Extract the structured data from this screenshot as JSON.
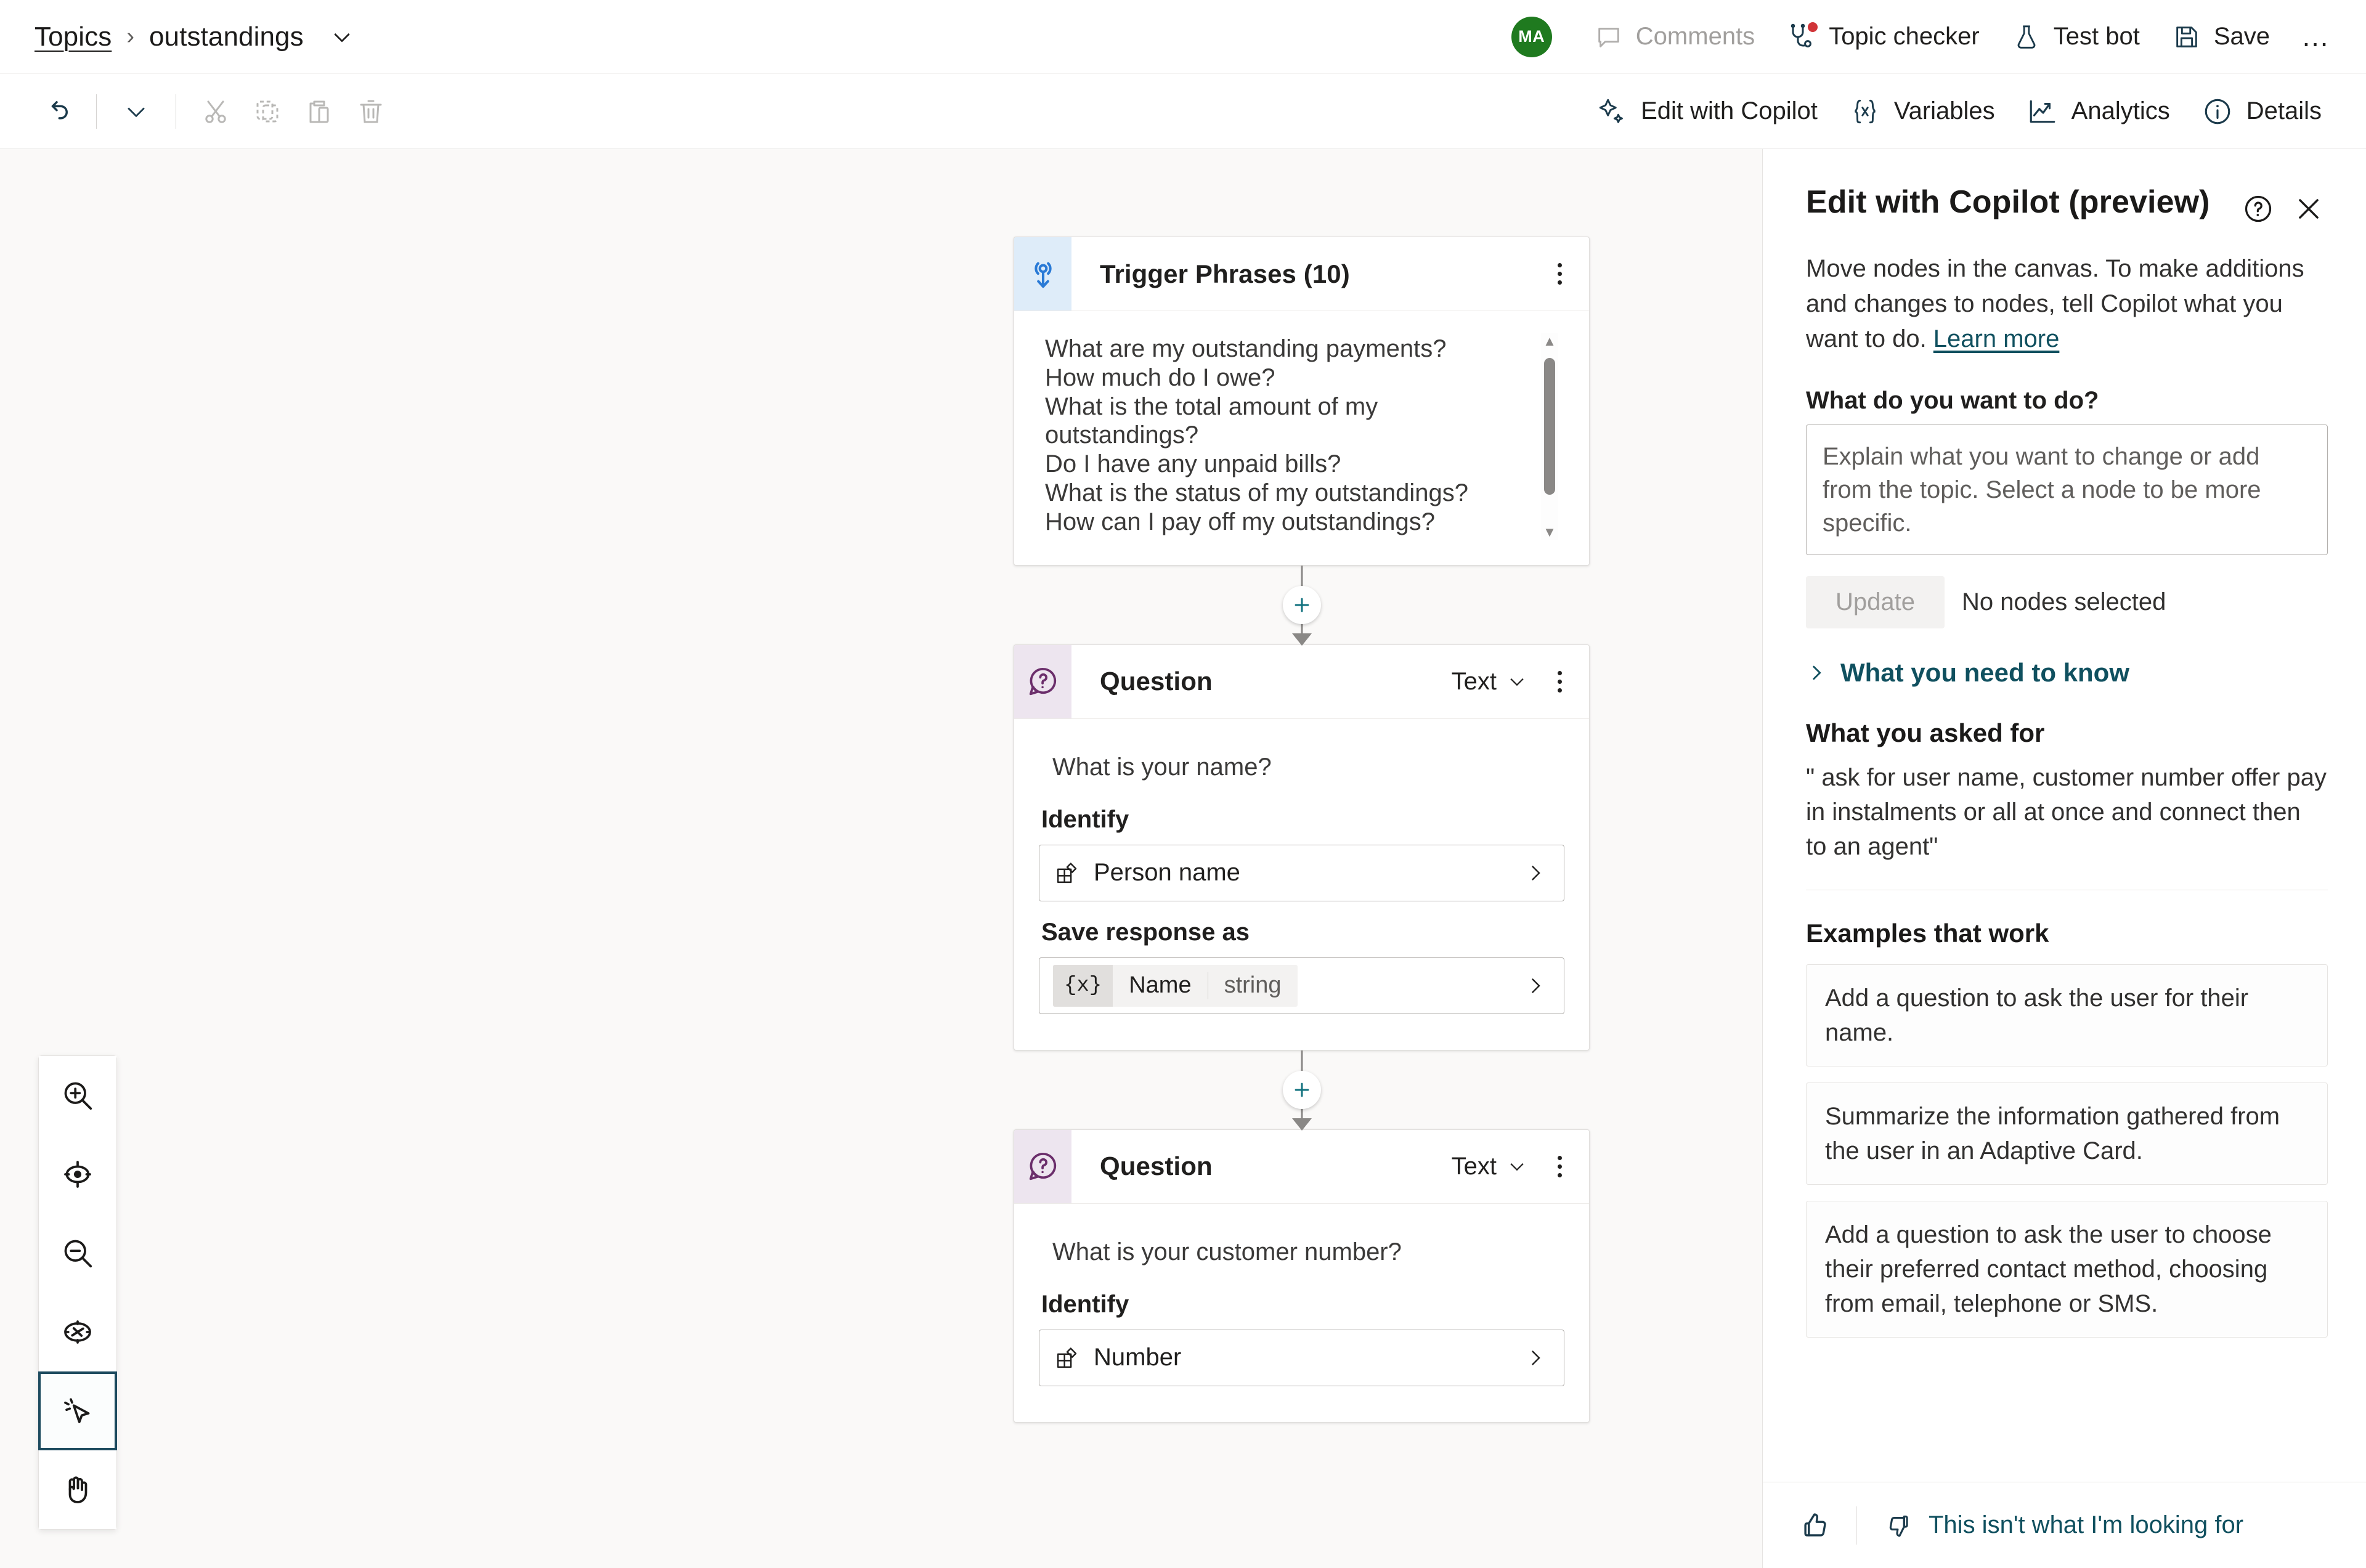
{
  "header": {
    "breadcrumb_root": "Topics",
    "breadcrumb_separator": "›",
    "breadcrumb_current": "outstandings",
    "avatar_initials": "MA",
    "avatar_color": "#1f7a1f",
    "actions": [
      {
        "label": "Comments",
        "icon": "comment-icon",
        "disabled": true
      },
      {
        "label": "Topic checker",
        "icon": "stethoscope-icon",
        "disabled": false,
        "badge": true
      },
      {
        "label": "Test bot",
        "icon": "flask-icon",
        "disabled": false
      },
      {
        "label": "Save",
        "icon": "save-icon",
        "disabled": false
      }
    ],
    "overflow_label": "…"
  },
  "toolbar": {
    "left": [
      {
        "name": "undo-button",
        "icon": "undo-icon"
      },
      {
        "name": "undo-dropdown-button",
        "icon": "chevron-down-icon"
      },
      {
        "name": "cut-button",
        "icon": "scissors-icon"
      },
      {
        "name": "copy-button",
        "icon": "copy-icon"
      },
      {
        "name": "paste-button",
        "icon": "clipboard-icon"
      },
      {
        "name": "delete-button",
        "icon": "trash-icon"
      }
    ],
    "right": [
      {
        "label": "Edit with Copilot",
        "icon": "sparkle-icon"
      },
      {
        "label": "Variables",
        "icon": "braces-x-icon"
      },
      {
        "label": "Analytics",
        "icon": "trend-up-icon"
      },
      {
        "label": "Details",
        "icon": "info-circle-icon"
      }
    ]
  },
  "canvas": {
    "zoom_rail": [
      {
        "name": "zoom-in-button",
        "icon": "zoom-in-icon",
        "selected": false
      },
      {
        "name": "fit-to-screen-button",
        "icon": "focus-target-icon",
        "selected": false
      },
      {
        "name": "zoom-out-button",
        "icon": "zoom-out-icon",
        "selected": false
      },
      {
        "name": "reset-view-button",
        "icon": "compass-icon",
        "selected": false
      },
      {
        "name": "select-tool-button",
        "icon": "pointer-click-icon",
        "selected": true
      },
      {
        "name": "pan-tool-button",
        "icon": "hand-icon",
        "selected": false
      }
    ],
    "nodes": [
      {
        "id": "trigger",
        "type": "trigger",
        "icon": "trigger-phrases-icon",
        "title": "Trigger Phrases (10)",
        "phrases": [
          "What are my outstanding payments?",
          "How much do I owe?",
          "What is the total amount of my outstandings?",
          "Do I have any unpaid bills?",
          "What is the status of my outstandings?",
          "How can I pay off my outstandings?"
        ]
      },
      {
        "id": "question-1",
        "type": "question",
        "icon": "question-icon",
        "title": "Question",
        "response_type": "Text",
        "prompt": "What is your name?",
        "identify_label": "Identify",
        "identify_value": "Person name",
        "save_label": "Save response as",
        "variable_prefix": "{x}",
        "variable_name": "Name",
        "variable_type": "string"
      },
      {
        "id": "question-2",
        "type": "question",
        "icon": "question-icon",
        "title": "Question",
        "response_type": "Text",
        "prompt": "What is your customer number?",
        "identify_label": "Identify",
        "identify_value": "Number"
      }
    ]
  },
  "panel": {
    "title": "Edit with Copilot (preview)",
    "help_icon": "question-circle-icon",
    "close_icon": "close-icon",
    "description_text": "Move nodes in the canvas. To make additions and changes to nodes, tell Copilot what you want to do. ",
    "description_link": "Learn more",
    "prompt_label": "What do you want to do?",
    "prompt_placeholder": "Explain what you want to change or add from the topic. Select a node to be more specific.",
    "update_button": "Update",
    "nodes_status": "No nodes selected",
    "disclosure_label": "What you need to know",
    "asked_label": "What you asked for",
    "asked_text": "\" ask for user name, customer number offer pay in instalments or all at once and connect then to an agent\"",
    "examples_label": "Examples that work",
    "examples": [
      "Add a question to ask the user for their name.",
      "Summarize the information gathered from the user in an Adaptive Card.",
      "Add a question to ask the user to choose their preferred contact method, choosing from email, telephone or SMS."
    ],
    "footer": {
      "like_icon": "thumbs-up-icon",
      "dislike_icon": "thumbs-down-icon",
      "feedback_label": "This isn't what I'm looking for"
    }
  }
}
